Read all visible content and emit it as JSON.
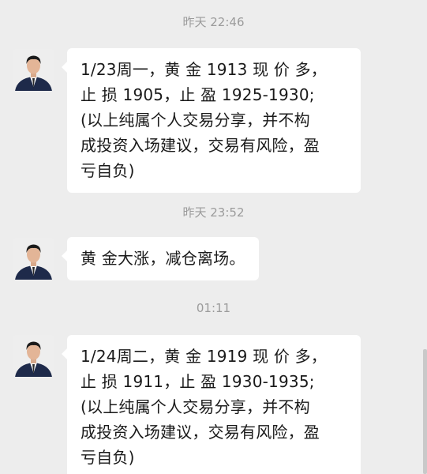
{
  "messages": [
    {
      "timestamp": "昨天 22:46",
      "text": "1/23周一，黄 金 1913 现 价 多，\n止 损 1905，止 盈 1925-1930;\n(以上纯属个人交易分享，并不构\n成投资入场建议，交易有风险，盈\n亏自负)"
    },
    {
      "timestamp": "昨天 23:52",
      "text": "黄 金大涨，减仓离场。"
    },
    {
      "timestamp": "01:11",
      "text": "1/24周二，黄 金 1919 现 价 多，\n止 损 1911，止 盈 1930-1935;\n(以上纯属个人交易分享，并不构\n成投资入场建议，交易有风险，盈\n亏自负)"
    }
  ]
}
